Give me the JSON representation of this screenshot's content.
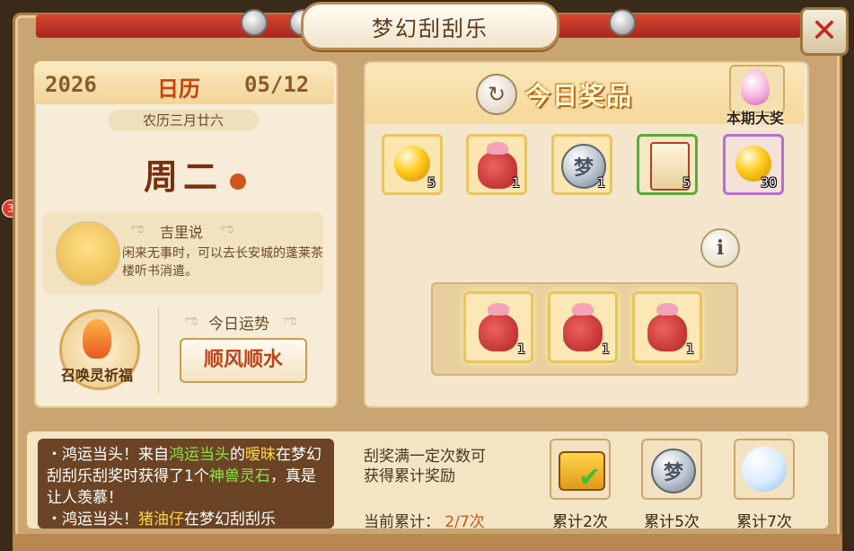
{
  "window": {
    "title": "梦幻刮刮乐"
  },
  "side_badge": "3",
  "calendar": {
    "year": "2026",
    "label": "日历",
    "month_day": "05/12",
    "lunar": "农历三月廿六",
    "weekday": "周二",
    "tip_title": "吉里说",
    "tip_text": "闲来无事时，可以去长安城的蓬莱茶楼听书消遣。",
    "summon_label": "召唤灵祈福",
    "fortune_title": "今日运势",
    "fortune_value": "顺风顺水"
  },
  "prizes": {
    "title": "今日奖品",
    "grand_prize_label": "本期大奖",
    "items": [
      {
        "icon": "gold-orb-icon",
        "qty": "5",
        "border": "gold"
      },
      {
        "icon": "red-gift-bag-icon",
        "qty": "1",
        "border": "gold"
      },
      {
        "icon": "silver-coin-icon",
        "qty": "1",
        "border": "gold"
      },
      {
        "icon": "scroll-icon",
        "qty": "5",
        "border": "green"
      },
      {
        "icon": "gold-orb-icon",
        "qty": "30",
        "border": "purple"
      }
    ],
    "winnings": [
      {
        "icon": "red-gift-bag-icon",
        "qty": "1"
      },
      {
        "icon": "red-gift-bag-icon",
        "qty": "1"
      },
      {
        "icon": "red-gift-bag-icon",
        "qty": "1"
      }
    ]
  },
  "news": {
    "line1_a": "・鸿运当头！来自",
    "line1_name": "鸿运当头",
    "line1_b": "的",
    "line1_c": "暧昧",
    "line1_d": "在梦幻刮刮乐刮奖时获得了1个",
    "line1_item": "神兽灵石",
    "line1_e": "，真是让人羡慕！",
    "line2_a": "・鸿运当头！",
    "line2_name": "猪油仔",
    "line2_b": "在梦幻刮刮乐"
  },
  "rewards": {
    "desc_line1": "刮奖满一定次数可",
    "desc_line2": "获得累计奖励",
    "progress_label": "当前累计：",
    "progress_value": "2/7次",
    "tiers": [
      {
        "icon": "treasure-chest-icon",
        "label": "累计2次",
        "claimed": true
      },
      {
        "icon": "silver-coin-icon",
        "label": "累计5次",
        "claimed": false
      },
      {
        "icon": "snow-orb-icon",
        "label": "累计7次",
        "claimed": false
      }
    ]
  }
}
